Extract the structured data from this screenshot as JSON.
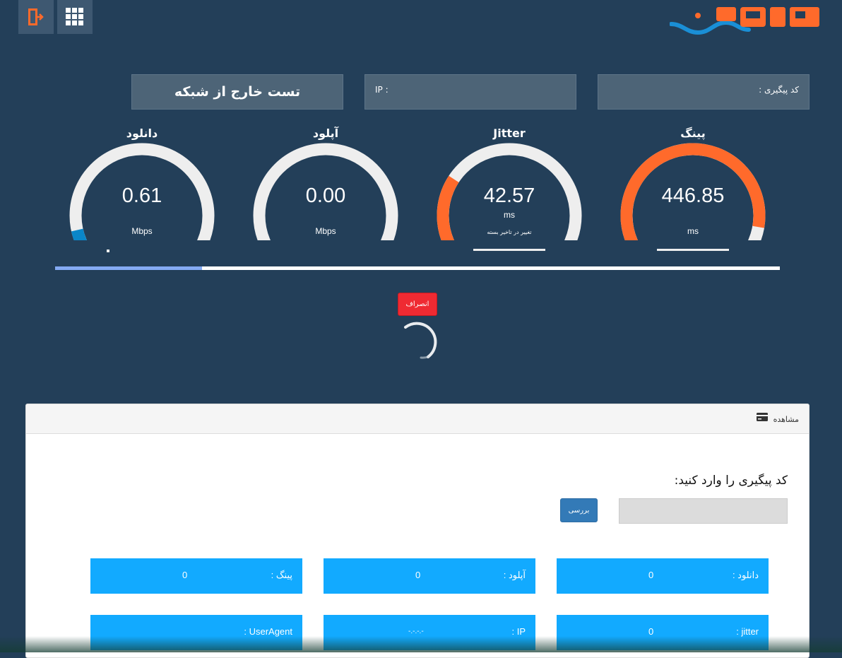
{
  "topbar": {
    "logout_icon": "exit-door-icon",
    "apps_icon": "grid-icon",
    "logo_icon": "brand-logo"
  },
  "info": {
    "title": "تست خارج از شبکه",
    "ip_label": "IP :",
    "tracking_label": "کد پیگیری :"
  },
  "gauges": {
    "download": {
      "title": "دانلود",
      "value": "0.61",
      "unit": "Mbps",
      "fraction": 0.12
    },
    "upload": {
      "title": "آپلود",
      "value": "0.00",
      "unit": "Mbps",
      "fraction": 0.0
    },
    "jitter": {
      "title": "Jitter",
      "value": "42.57",
      "unit": "ms",
      "sub": "تغییر در تاخیر بسته",
      "fraction": 0.29
    },
    "ping": {
      "title": "پینگ",
      "value": "446.85",
      "unit": "ms",
      "fraction": 0.87
    }
  },
  "progress": {
    "fraction": 0.203
  },
  "actions": {
    "cancel_label": "انصراف"
  },
  "panel": {
    "header_label": "مشاهده",
    "header_icon": "card-icon",
    "enter_label": "کد پیگیری را وارد کنید:",
    "input_value": "",
    "check_label": "بررسی",
    "stats": {
      "download": {
        "label": "دانلود :",
        "value": "0"
      },
      "upload": {
        "label": "آپلود :",
        "value": "0"
      },
      "ping": {
        "label": "پینگ :",
        "value": "0"
      },
      "jitter": {
        "label": "jitter :",
        "value": "0"
      },
      "ip": {
        "label": "IP :",
        "value": "-.-.-.-"
      },
      "useragent": {
        "label": "UserAgent :",
        "value": ""
      }
    }
  },
  "colors": {
    "background": "#233f59",
    "orange": "#ff6a2b",
    "blue_gauge": "#0a86c9",
    "track": "#eeeeee",
    "stat_box": "#12aaff",
    "cancel": "#ef2a32",
    "check": "#337ab7"
  }
}
